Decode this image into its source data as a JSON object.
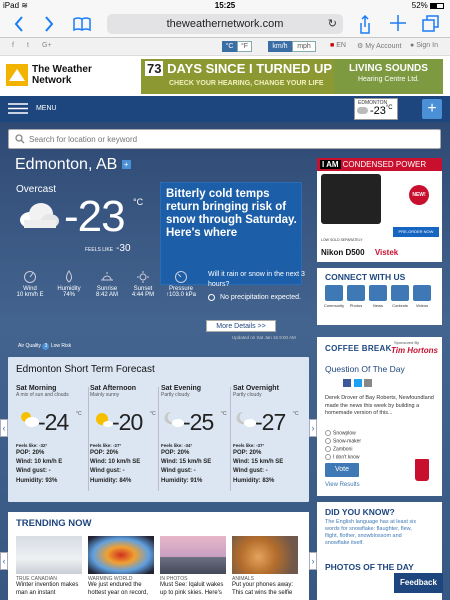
{
  "status": {
    "device": "iPad",
    "wifi": "wifi-icon",
    "time": "15:25",
    "battery": "52%"
  },
  "browser": {
    "url": "theweathernetwork.com",
    "back": "back-icon",
    "forward": "forward-icon",
    "bookmarks": "book-icon",
    "reload": "reload-icon",
    "share": "share-icon",
    "newtab": "plus-icon",
    "tabs": "tabs-icon"
  },
  "util": {
    "temp_c": "°C",
    "temp_f": "°F",
    "speed_kmh": "km/h",
    "speed_mph": "mph",
    "lang": "EN",
    "account": "My Account",
    "signin": "Sign In"
  },
  "header": {
    "logo_line1": "The Weather",
    "logo_line2": "Network",
    "banner_count": "73",
    "banner_headline": "DAYS SINCE I TURNED UP THE TV",
    "banner_sub": "CHECK YOUR HEARING, CHANGE YOUR LIFE",
    "banner_brand1": "LIVING SOUNDS",
    "banner_brand2": "Hearing Centre Ltd."
  },
  "nav": {
    "menu": "MENU",
    "city": "EDMONTON",
    "temp": "-23",
    "unit": "°C",
    "plus": "+"
  },
  "search": {
    "placeholder": "Search for location or keyword"
  },
  "weather": {
    "city": "Edmonton, AB",
    "condition": "Overcast",
    "temp": "-23",
    "unit": "°C",
    "feels_label": "FEELS LIKE",
    "feels_value": "-30",
    "news": "Bitterly cold temps return bringing risk of snow through Saturday. Here's where",
    "obs": [
      {
        "label": "Wind",
        "value": "10 km/h E"
      },
      {
        "label": "Humidity",
        "value": "74%"
      },
      {
        "label": "Sunrise",
        "value": "8:42 AM"
      },
      {
        "label": "Sunset",
        "value": "4:44 PM"
      },
      {
        "label": "Pressure",
        "value": "↑103.0 kPa"
      }
    ],
    "aqi_label": "Air Quality",
    "aqi_value": "Low Risk",
    "aqi_num": "3",
    "rain_q": "Will it rain or snow in the next 3 hours?",
    "rain_a": "No precipitation expected.",
    "more": "More Details >>",
    "updated": "Updated on Sat Jan 16 9:00 AM"
  },
  "forecast": {
    "title": "Edmonton Short Term Forecast",
    "items": [
      {
        "time": "Sat Morning",
        "sky": "A mix of sun and clouds",
        "temp": "-24",
        "unit": "°C",
        "feels": "Feels like: -32°",
        "pop": "POP: 20%",
        "wind": "Wind: 10 km/h E",
        "gust": "Wind gust: -",
        "hum": "Humidity: 93%"
      },
      {
        "time": "Sat Afternoon",
        "sky": "Mainly sunny",
        "temp": "-20",
        "unit": "°C",
        "feels": "Feels like: -27°",
        "pop": "POP: 20%",
        "wind": "Wind: 10 km/h SE",
        "gust": "Wind gust: -",
        "hum": "Humidity: 84%"
      },
      {
        "time": "Sat Evening",
        "sky": "Partly cloudy",
        "temp": "-25",
        "unit": "°C",
        "feels": "Feels like: -34°",
        "pop": "POP: 20%",
        "wind": "Wind: 15 km/h SE",
        "gust": "Wind gust: -",
        "hum": "Humidity: 91%"
      },
      {
        "time": "Sat Overnight",
        "sky": "Partly cloudy",
        "temp": "-27",
        "unit": "°C",
        "feels": "Feels like: -37°",
        "pop": "POP: 20%",
        "wind": "Wind: 15 km/h SE",
        "gust": "Wind gust: -",
        "hum": "Humidity: 83%"
      }
    ]
  },
  "trending": {
    "title": "TRENDING NOW",
    "items": [
      {
        "cat": "TRUE CANADIAN",
        "title": "Winter invention makes man an instant"
      },
      {
        "cat": "WARMING WORLD",
        "title": "We just endured the hottest year on record,"
      },
      {
        "cat": "IN PHOTOS",
        "title": "Must See: Iqaluit wakes up to pink skies. Here's"
      },
      {
        "cat": "ANIMALS",
        "title": "Put your phones away: This cat wins the selfie"
      }
    ]
  },
  "ad": {
    "brand": "I AM",
    "tag": "CONDENSED POWER",
    "new": "NEW!",
    "preorder": "PRE-ORDER NOW",
    "low": "LOW SOLD SEPARATELY",
    "nikon": "Nikon D500",
    "vistek": "Vistek"
  },
  "connect": {
    "title": "CONNECT WITH US",
    "items": [
      "Community",
      "Photos",
      "News",
      "Contests",
      "Videos"
    ]
  },
  "coffee": {
    "title": "COFFEE BREAK",
    "sponsored": "Sponsored By",
    "sponsor": "Tim Hortons",
    "question_title": "Question Of The Day",
    "question": "Derek Drover of Bay Roberts, Newfoundland made the news this week by building a homemade version of this...",
    "options": [
      "Snowplow",
      "Snow-maker",
      "Zamboni",
      "I don't know"
    ],
    "vote": "Vote",
    "results": "View Results"
  },
  "dyk": {
    "title": "DID YOU KNOW?",
    "text": "The English language has at least six words for snowflake: flaughter, flew, flight, flother, snowblossom and snowflake itself."
  },
  "potd": {
    "title": "PHOTOS OF THE DAY"
  },
  "feedback": "Feedback",
  "colors": {
    "navy": "#1e467e",
    "accent": "#3a6ea5",
    "news": "#1c5ea7",
    "forecast_bg": "#dbe6f2"
  }
}
